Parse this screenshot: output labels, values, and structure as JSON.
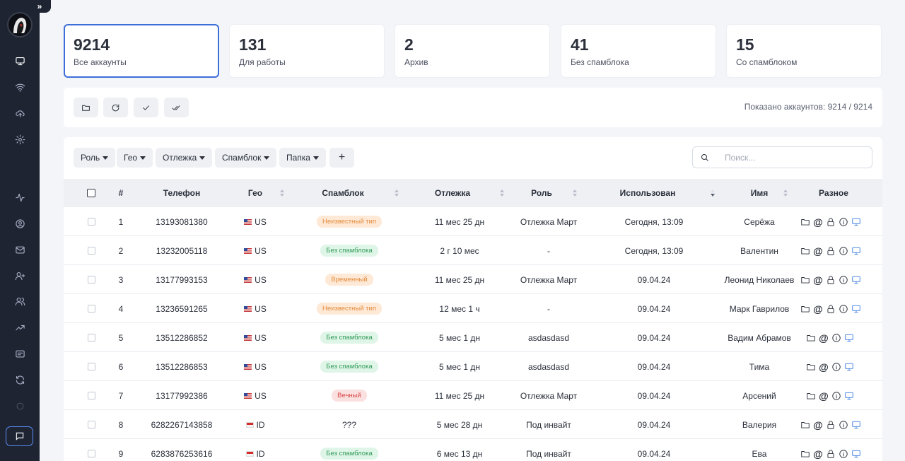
{
  "stats": [
    {
      "value": "9214",
      "label": "Все аккаунты"
    },
    {
      "value": "131",
      "label": "Для работы"
    },
    {
      "value": "2",
      "label": "Архив"
    },
    {
      "value": "41",
      "label": "Без спамблока"
    },
    {
      "value": "15",
      "label": "Со спамблоком"
    }
  ],
  "toolbar": {
    "shown": "Показано аккаунтов: 9214 / 9214"
  },
  "filters": [
    "Роль",
    "Гео",
    "Отлежка",
    "Спамблок",
    "Папка"
  ],
  "filter_add": "+",
  "search": {
    "placeholder": "Поиск..."
  },
  "columns": [
    "#",
    "Телефон",
    "Гео",
    "Спамблок",
    "Отлежка",
    "Роль",
    "Использован",
    "Имя",
    "Разное"
  ],
  "rows": [
    {
      "n": "1",
      "phone": "13193081380",
      "geo": "US",
      "spam": "Неизвестный тип",
      "spam_kind": "unknown",
      "age": "11 мес 25 дн",
      "role": "Отлежка Март",
      "used": "Сегодня, 13:09",
      "name": "Серёжа",
      "lock": true
    },
    {
      "n": "2",
      "phone": "13232005118",
      "geo": "US",
      "spam": "Без спамблока",
      "spam_kind": "none",
      "age": "2 г 10 мес",
      "role": "-",
      "used": "Сегодня, 13:09",
      "name": "Валентин",
      "lock": true
    },
    {
      "n": "3",
      "phone": "13177993153",
      "geo": "US",
      "spam": "Временный",
      "spam_kind": "temp",
      "age": "11 мес 25 дн",
      "role": "Отлежка Март",
      "used": "09.04.24",
      "name": "Леонид Николаев",
      "lock": true
    },
    {
      "n": "4",
      "phone": "13236591265",
      "geo": "US",
      "spam": "Неизвестный тип",
      "spam_kind": "unknown",
      "age": "12 мес 1 ч",
      "role": "-",
      "used": "09.04.24",
      "name": "Марк Гаврилов",
      "lock": true
    },
    {
      "n": "5",
      "phone": "13512286852",
      "geo": "US",
      "spam": "Без спамблока",
      "spam_kind": "none",
      "age": "5 мес 1 дн",
      "role": "asdasdasd",
      "used": "09.04.24",
      "name": "Вадим Абрамов",
      "lock": false
    },
    {
      "n": "6",
      "phone": "13512286853",
      "geo": "US",
      "spam": "Без спамблока",
      "spam_kind": "none",
      "age": "5 мес 1 дн",
      "role": "asdasdasd",
      "used": "09.04.24",
      "name": "Тима",
      "lock": false
    },
    {
      "n": "7",
      "phone": "13177992386",
      "geo": "US",
      "spam": "Вечный",
      "spam_kind": "perm",
      "age": "11 мес 25 дн",
      "role": "Отлежка Март",
      "used": "09.04.24",
      "name": "Арсений",
      "lock": false
    },
    {
      "n": "8",
      "phone": "6282267143858",
      "geo": "ID",
      "spam": "???",
      "spam_kind": "text",
      "age": "5 мес 28 дн",
      "role": "Под инвайт",
      "used": "09.04.24",
      "name": "Валерия",
      "lock": true
    },
    {
      "n": "9",
      "phone": "6283876253616",
      "geo": "ID",
      "spam": "Без спамблока",
      "spam_kind": "none",
      "age": "6 мес 13 дн",
      "role": "Под инвайт",
      "used": "09.04.24",
      "name": "Ева",
      "lock": true
    }
  ],
  "colors": {
    "sidebar": "#1f2433",
    "accent": "#3d6fd8"
  }
}
